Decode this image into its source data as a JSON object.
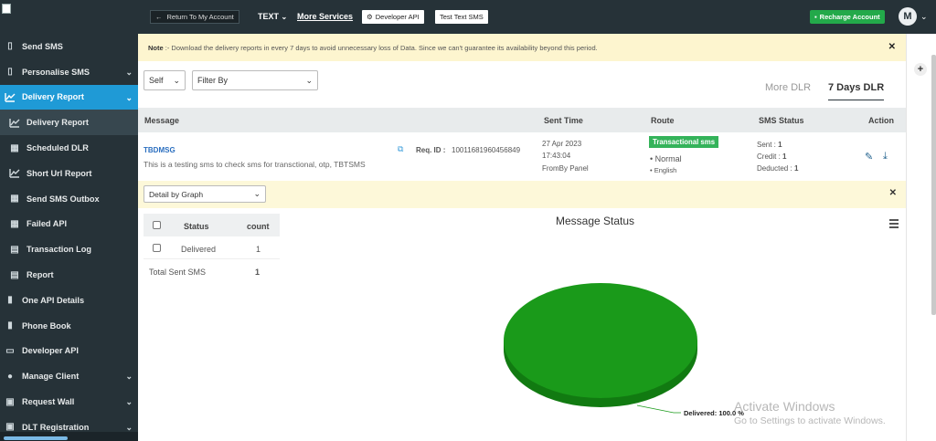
{
  "sidebar": {
    "items": [
      {
        "label": "Send SMS",
        "icon": "send-sms-icon"
      },
      {
        "label": "Personalise SMS",
        "icon": "phone-sms-icon"
      },
      {
        "label": "Delivery Report",
        "icon": "chart-line-icon"
      },
      {
        "label": "Delivery Report",
        "icon": "chart-line-icon"
      },
      {
        "label": "Scheduled DLR",
        "icon": "calendar-icon"
      },
      {
        "label": "Short Url Report",
        "icon": "chart-line-icon"
      },
      {
        "label": "Send SMS Outbox",
        "icon": "outbox-icon"
      },
      {
        "label": "Failed API",
        "icon": "calendar-x-icon"
      },
      {
        "label": "Transaction Log",
        "icon": "document-icon"
      },
      {
        "label": "Report",
        "icon": "document-icon"
      },
      {
        "label": "One API Details",
        "icon": "api-book-icon"
      },
      {
        "label": "Phone Book",
        "icon": "address-book-icon"
      },
      {
        "label": "Developer API",
        "icon": "monitor-icon"
      },
      {
        "label": "Manage Client",
        "icon": "users-icon"
      },
      {
        "label": "Request Wall",
        "icon": "request-icon"
      },
      {
        "label": "DLT Registration",
        "icon": "registration-icon"
      }
    ]
  },
  "topbar": {
    "return_label": "Return To My Account",
    "text_menu": "TEXT",
    "more_services": "More Services",
    "developer_api": "Developer API",
    "test_text_sms": "Test Text SMS",
    "recharge": "Recharge Account",
    "avatar_initial": "M"
  },
  "notice": {
    "label": "Note",
    "text": ":- Download the delivery reports in every 7 days to avoid unnecessary loss of Data. Since we can't guarantee its availability beyond this period."
  },
  "filters": {
    "scope_value": "Self",
    "filter_value": "Filter By"
  },
  "tabs": [
    {
      "label": "More DLR",
      "active": false
    },
    {
      "label": "7 Days DLR",
      "active": true
    }
  ],
  "table": {
    "headers": [
      "Message",
      "Sent Time",
      "Route",
      "SMS Status",
      "Action"
    ],
    "row": {
      "sender": "TBDMSG",
      "message": "This is a testing sms to check sms for transctional, otp, TBTSMS",
      "req_label": "Req. ID :",
      "req_id": "10011681960456849",
      "date": "27 Apr 2023",
      "time": "17:43:04",
      "source": "FromBy Panel",
      "route_badge": "Transactional sms",
      "route_type": "Normal",
      "language": "English",
      "sent_label": "Sent :",
      "sent_value": "1",
      "credit_label": "Credit :",
      "credit_value": "1",
      "deducted_label": "Deducted :",
      "deducted_value": "1"
    }
  },
  "detail": {
    "select_value": "Detail by Graph"
  },
  "status_table": {
    "headers": [
      "Status",
      "count"
    ],
    "rows": [
      {
        "status": "Delivered",
        "count": "1"
      }
    ],
    "total_label": "Total Sent SMS",
    "total_value": "1"
  },
  "chart_data": {
    "type": "pie",
    "title": "Message Status",
    "slices": [
      {
        "name": "Delivered",
        "value": 100.0,
        "label": "Delivered: 100.0 %",
        "color": "#1a9a1a"
      }
    ]
  },
  "watermark": {
    "line1": "Activate Windows",
    "line2": "Go to Settings to activate Windows."
  },
  "colors": {
    "sidebar_bg": "#263238",
    "active_blue": "#1f9ad6",
    "success_green": "#23a94a",
    "pie_green": "#1a9a1a"
  }
}
